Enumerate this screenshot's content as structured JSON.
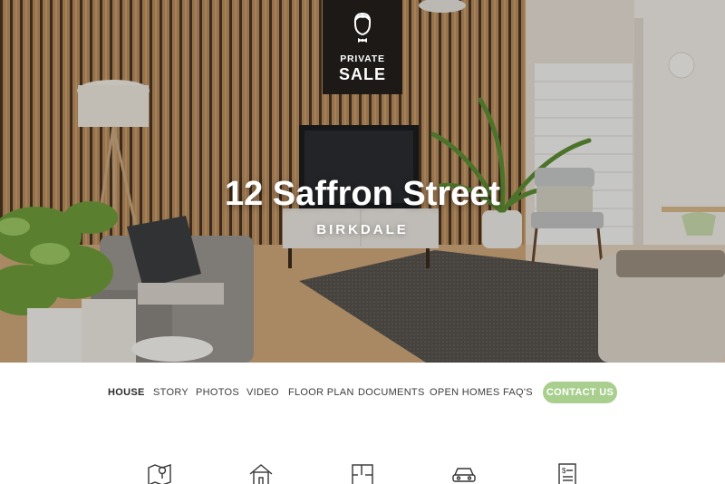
{
  "badge": {
    "line1": "PRIVATE",
    "line2": "SALE",
    "icon": "person-bowtie-icon"
  },
  "hero": {
    "title": "12 Saffron Street",
    "subtitle": "BIRKDALE"
  },
  "nav": {
    "items": [
      {
        "label": "HOUSE",
        "active": true
      },
      {
        "label": "STORY"
      },
      {
        "label": "PHOTOS"
      },
      {
        "label": "VIDEO"
      },
      {
        "label": "FLOOR PLAN"
      },
      {
        "label": "DOCUMENTS"
      },
      {
        "label": "OPEN HOMES"
      },
      {
        "label": "FAQ'S"
      }
    ],
    "contact_label": "CONTACT US"
  },
  "features": [
    {
      "icon": "map-location-icon"
    },
    {
      "icon": "house-icon"
    },
    {
      "icon": "floor-plan-icon"
    },
    {
      "icon": "car-icon"
    },
    {
      "icon": "price-document-icon"
    }
  ],
  "colors": {
    "accent": "#a9cf8f",
    "badge_bg": "#1c1917",
    "text": "#3d3d3d"
  }
}
